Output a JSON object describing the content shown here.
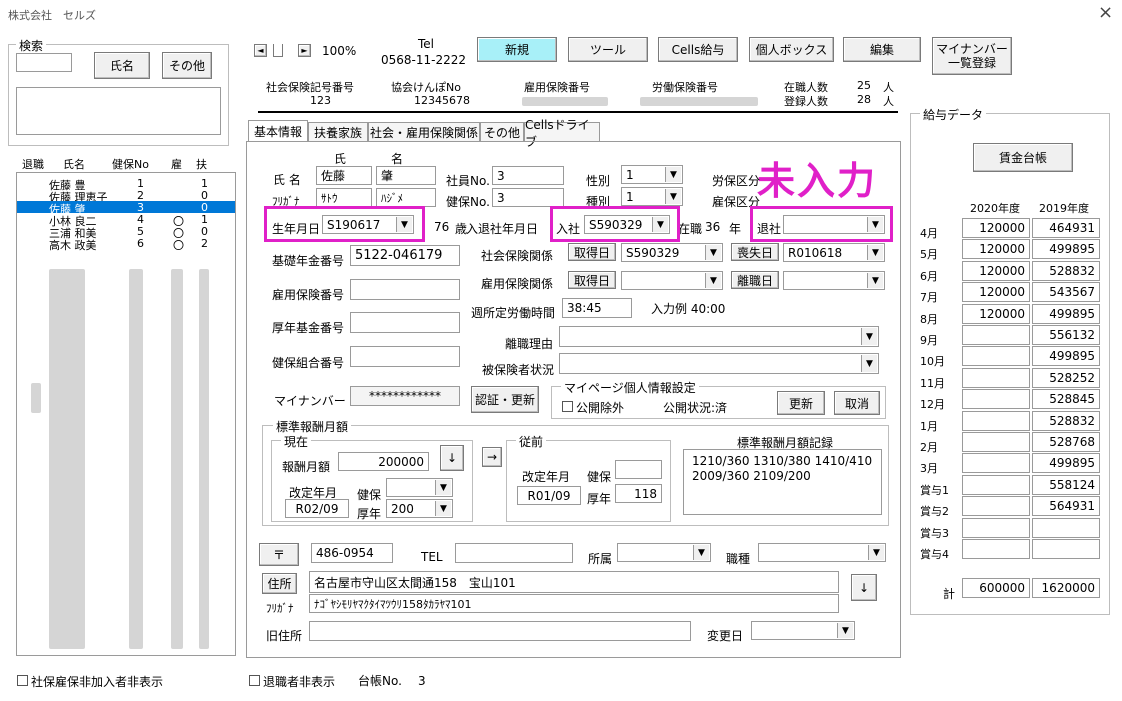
{
  "window": {
    "title": "株式会社　セルズ",
    "close": "×"
  },
  "search": {
    "title": "検索",
    "name_btn": "氏名",
    "other_btn": "その他",
    "input_value": "",
    "memo": ""
  },
  "employee_list": {
    "headers": {
      "status": "退職",
      "name": "氏名",
      "hoken": "健保No",
      "koyo": "雇",
      "fuyo": "扶"
    },
    "rows": [
      {
        "name": "佐藤 豊",
        "no": "1",
        "koyo": "",
        "fuyo": "1"
      },
      {
        "name": "佐藤 理恵子",
        "no": "2",
        "koyo": "",
        "fuyo": "0"
      },
      {
        "name": "佐藤 肇",
        "no": "3",
        "koyo": "",
        "fuyo": "0",
        "selected": true
      },
      {
        "name": "小林 良二",
        "no": "4",
        "koyo": "〇",
        "fuyo": "1"
      },
      {
        "name": "三浦 和美",
        "no": "5",
        "koyo": "〇",
        "fuyo": "0"
      },
      {
        "name": "高木 政美",
        "no": "6",
        "koyo": "〇",
        "fuyo": "2"
      }
    ]
  },
  "toolbar": {
    "zoom": "100%",
    "tel_label": "Tel",
    "tel_value": "0568-11-2222",
    "new": "新規",
    "tools": "ツール",
    "cells_pay": "Cells給与",
    "personal_box": "個人ボックス",
    "edit": "編集",
    "mynumber_line1": "マイナンバー",
    "mynumber_line2": "一覧登録"
  },
  "company_info": {
    "shaho_label": "社会保険記号番号",
    "shaho_value": "123",
    "kyokai_label": "協会けんぽNo",
    "kyokai_value": "12345678",
    "koyo_label": "雇用保険番号",
    "rodo_label": "労働保険番号",
    "zaishoku_label": "在職人数",
    "zaishoku_value": "25",
    "zaishoku_unit": "人",
    "toroku_label": "登録人数",
    "toroku_value": "28",
    "toroku_unit": "人"
  },
  "tabs": [
    "基本情報",
    "扶養家族",
    "社会・雇用保険関係",
    "その他",
    "Cellsドライブ"
  ],
  "annotation": "未入力",
  "form": {
    "name_label": "氏 名",
    "furigana_label": "ﾌﾘｶﾞﾅ",
    "sei_header": "氏",
    "mei_header": "名",
    "sei": "佐藤",
    "mei": "肇",
    "sei_kana": "ｻﾄｳ",
    "mei_kana": "ﾊｼﾞﾒ",
    "shain_label": "社員No.",
    "shain_value": "3",
    "kenpo_label": "健保No.",
    "kenpo_value": "3",
    "seibetsu_label": "性別",
    "seibetsu_value": "1",
    "shubetsu_label": "種別",
    "shubetsu_value": "1",
    "rosai_label": "労保区分",
    "koyo_kubun_label": "雇保区分",
    "birth_label": "生年月日",
    "birth_value": "S190617",
    "age_value": "76",
    "age_unit": "歳",
    "nyutai_label": "入退社年月日",
    "nyusha_label": "入社",
    "nyusha_value": "S590329",
    "zaishoku_label": "在職",
    "zaishoku_years": "36",
    "zaishoku_unit": "年",
    "taisha_label": "退社",
    "taisha_value": "",
    "kiso_label": "基礎年金番号",
    "kiso_value": "5122-046179",
    "koyo_no_label": "雇用保険番号",
    "kosei_label": "厚年基金番号",
    "kumiai_label": "健保組合番号",
    "shaho_rel_label": "社会保険関係",
    "shutoku_btn": "取得日",
    "shaho_shutoku": "S590329",
    "soshitsu_btn": "喪失日",
    "soshitsu_value": "R010618",
    "koyo_rel_label": "雇用保険関係",
    "koyo_shutoku_btn": "取得日",
    "rishoku_btn": "離職日",
    "shotei_label": "週所定労働時間",
    "shotei_value": "38:45",
    "nyuryoku_rei": "入力例 40:00",
    "rishoku_reason_label": "離職理由",
    "hihokensha_label": "被保険者状況",
    "mynumber_label": "マイナンバー",
    "mynumber_value": "************",
    "auth_btn": "認証・更新",
    "mypage_title": "マイページ個人情報設定",
    "public_exclude": "公開除外",
    "public_status": "公開状況:済",
    "update_btn": "更新",
    "cancel_btn": "取消"
  },
  "standard_pay": {
    "title": "標準報酬月額",
    "current_title": "現在",
    "monthly_label": "報酬月額",
    "monthly_value": "200000",
    "down_arrow": "↓",
    "right_arrow": "→",
    "revision_label": "改定年月",
    "revision_value": "R02/09",
    "kenpo_label": "健保",
    "kenpo_value": "",
    "kounen_label": "厚年",
    "kounen_value": "200",
    "prev_title": "従前",
    "prev_revision_label": "改定年月",
    "prev_revision_value": "R01/09",
    "prev_kenpo_label": "健保",
    "prev_kenpo_value": "",
    "prev_kounen_label": "厚年",
    "prev_kounen_value": "118",
    "record_title": "標準報酬月額記録",
    "record_line1": "1210/360 1310/380 1410/410",
    "record_line2": "2009/360 2109/200"
  },
  "address": {
    "zip_btn": "〒",
    "zip_value": "486-0954",
    "tel_label": "TEL",
    "shozoku_label": "所属",
    "shokushu_label": "職種",
    "jusho_btn": "住所",
    "jusho_value": "名古屋市守山区太間通158　宝山101",
    "kana_label": "ﾌﾘｶﾞﾅ",
    "kana_value": "ﾅｺﾞﾔｼﾓﾘﾔﾏｸﾀｲﾏﾂｳﾘ158ﾀｶﾗﾔﾏ101",
    "down_btn": "↓",
    "old_label": "旧住所",
    "henko_label": "変更日"
  },
  "salary": {
    "title": "給与データ",
    "ledger_btn": "賃金台帳",
    "year1": "2020年度",
    "year2": "2019年度",
    "rows": [
      {
        "month": "4月",
        "y2020": "120000",
        "y2019": "464931"
      },
      {
        "month": "5月",
        "y2020": "120000",
        "y2019": "499895"
      },
      {
        "month": "6月",
        "y2020": "120000",
        "y2019": "528832"
      },
      {
        "month": "7月",
        "y2020": "120000",
        "y2019": "543567"
      },
      {
        "month": "8月",
        "y2020": "120000",
        "y2019": "499895"
      },
      {
        "month": "9月",
        "y2020": "",
        "y2019": "556132"
      },
      {
        "month": "10月",
        "y2020": "",
        "y2019": "499895"
      },
      {
        "month": "11月",
        "y2020": "",
        "y2019": "528252"
      },
      {
        "month": "12月",
        "y2020": "",
        "y2019": "528845"
      },
      {
        "month": "1月",
        "y2020": "",
        "y2019": "528832"
      },
      {
        "month": "2月",
        "y2020": "",
        "y2019": "528768"
      },
      {
        "month": "3月",
        "y2020": "",
        "y2019": "499895"
      },
      {
        "month": "賞与1",
        "y2020": "",
        "y2019": "558124"
      },
      {
        "month": "賞与2",
        "y2020": "",
        "y2019": "564931"
      },
      {
        "month": "賞与3",
        "y2020": "",
        "y2019": ""
      },
      {
        "month": "賞与4",
        "y2020": "",
        "y2019": ""
      }
    ],
    "total_label": "計",
    "total_2020": "600000",
    "total_2019": "1620000"
  },
  "footer": {
    "hide_shaho": "社保雇保非加入者非表示",
    "hide_retired": "退職者非表示",
    "daicho_label": "台帳No.",
    "daicho_value": "3"
  },
  "colors": {
    "accent_button": "#a8f0f8",
    "highlight": "#e020c8",
    "selected_row": "#0078d7"
  }
}
